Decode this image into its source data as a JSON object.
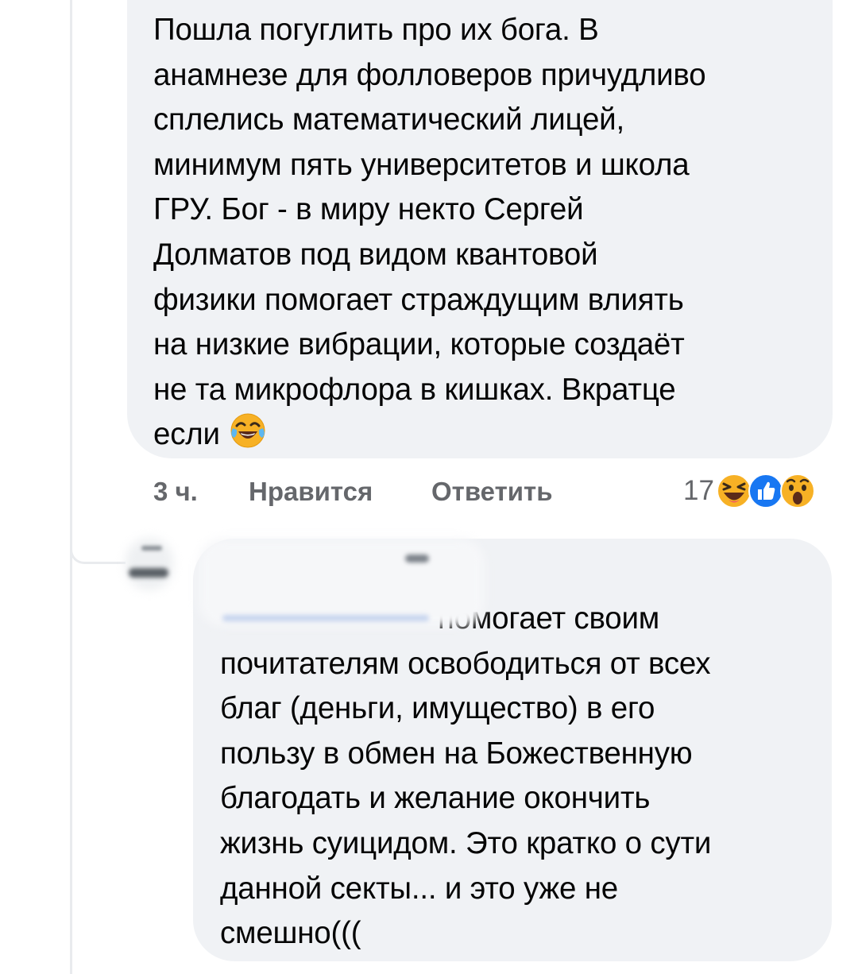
{
  "comment": {
    "lines": [
      "Пошла погуглить про их бога. В",
      "анамнезе для фолловеров причудливо",
      "сплелись  математический лицей,",
      "минимум пять университетов и школа",
      "ГРУ. Бог - в миру некто Сергей",
      "Долматов под видом квантовой",
      "физики помогает страждущим влиять",
      "на низкие вибрации, которые создаёт",
      "не та микрофлора в кишках. Вкратце",
      "если"
    ],
    "trailing_emoji": "face-with-tears-of-joy-icon",
    "time": "3 ч.",
    "like_label": "Нравится",
    "reply_label": "Ответить",
    "reaction_count": "17",
    "reactions": [
      "haha-icon",
      "like-icon",
      "wow-icon"
    ]
  },
  "reply": {
    "lines": [
      "помогает своим",
      "почитателям освободиться от всех",
      "благ (деньги, имущество) в его",
      "пользу в обмен на Божественную",
      "благодать и желание окончить",
      "жизнь суицидом. Это кратко о сути",
      "данной секты... и это уже не",
      "смешно((("
    ]
  },
  "colors": {
    "bubble": "#f0f2f5",
    "text": "#050505",
    "meta": "#65676b",
    "like_blue": "#1877f2",
    "emoji_yellow": "#f7b125"
  }
}
